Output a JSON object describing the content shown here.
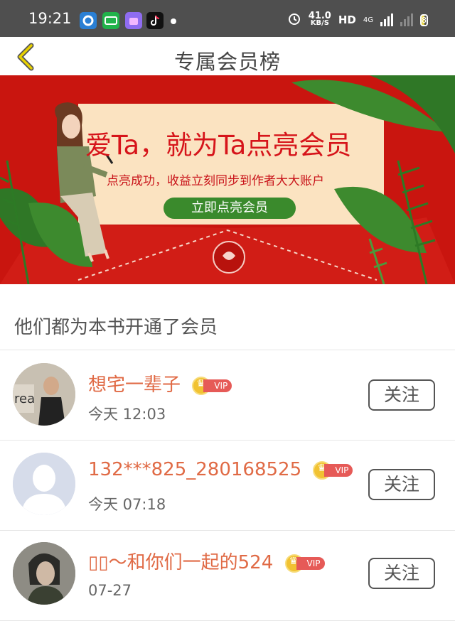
{
  "status_bar": {
    "time": "19:21",
    "speed_value": "41.0",
    "speed_unit": "KB/S",
    "hd_label": "HD",
    "network_label": "4G",
    "battery": "8",
    "icons": [
      "browser-app-icon",
      "iqiyi-app-icon",
      "store-app-icon",
      "tiktok-app-icon",
      "notification-dot-icon",
      "alarm-icon",
      "signal-icon",
      "battery-icon"
    ]
  },
  "header": {
    "title": "专属会员榜",
    "back_icon": "chevron-left-icon"
  },
  "banner": {
    "headline": "爱Ta，就为Ta点亮会员",
    "subtitle": "点亮成功，收益立刻同步到作者大大账户",
    "cta": "立即点亮会员",
    "colors": {
      "background": "#cc1712",
      "card": "#fbe6c3",
      "leaf": "#3d8a2e",
      "cta": "#3a8a2c"
    }
  },
  "section": {
    "title": "他们都为本书开通了会员"
  },
  "vip_badge_label": "VIP",
  "members": [
    {
      "name": "想宅一辈子",
      "time": "今天 12:03",
      "follow_label": "关注",
      "avatar": "photo-avatar"
    },
    {
      "name": "132***825_280168525",
      "time": "今天 07:18",
      "follow_label": "关注",
      "avatar": "default-avatar"
    },
    {
      "name": "▯▯～和你们一起的524",
      "time": "07-27",
      "follow_label": "关注",
      "avatar": "photo-avatar"
    }
  ],
  "colors": {
    "name": "#e06a45",
    "vip": "#e65a57",
    "crown": "#f1c232",
    "back_arrow": "#e0c200"
  }
}
